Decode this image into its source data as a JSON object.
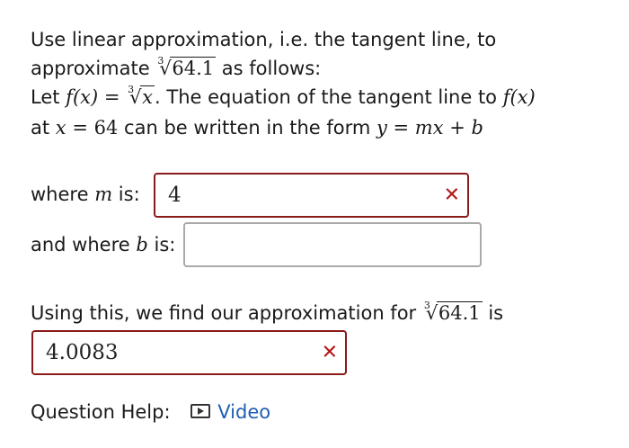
{
  "question": {
    "line1": "Use linear approximation, i.e. the tangent line, to",
    "line2_prefix": "approximate",
    "line2_suffix": "as follows:",
    "line3_prefix": "Let",
    "line3_mid": ". The equation of the tangent line to",
    "line4_prefix": "at",
    "line4_mid": "can be written in the form",
    "root_index": "3",
    "root_value": "64.1",
    "root_var": "x",
    "fx": "f(x)",
    "eq_sign": "=",
    "point_x": "x",
    "point_val": "64",
    "form": "y = mx + b"
  },
  "m_row": {
    "label_prefix": "where",
    "label_var": "m",
    "label_suffix": "is:",
    "value": "4",
    "status_icon": "x-mark-icon"
  },
  "b_row": {
    "label_prefix": "and where",
    "label_var": "b",
    "label_suffix": "is:",
    "value": ""
  },
  "approx": {
    "label_prefix": "Using this, we find our approximation for",
    "label_suffix": "is",
    "value": "4.0083",
    "status_icon": "x-mark-icon"
  },
  "help": {
    "label": "Question Help:",
    "video_label": "Video",
    "icon": "video-icon"
  },
  "colors": {
    "wrong_border": "#8b1a1a",
    "wrong_mark": "#b21a1a",
    "link": "#1f5fb4"
  }
}
